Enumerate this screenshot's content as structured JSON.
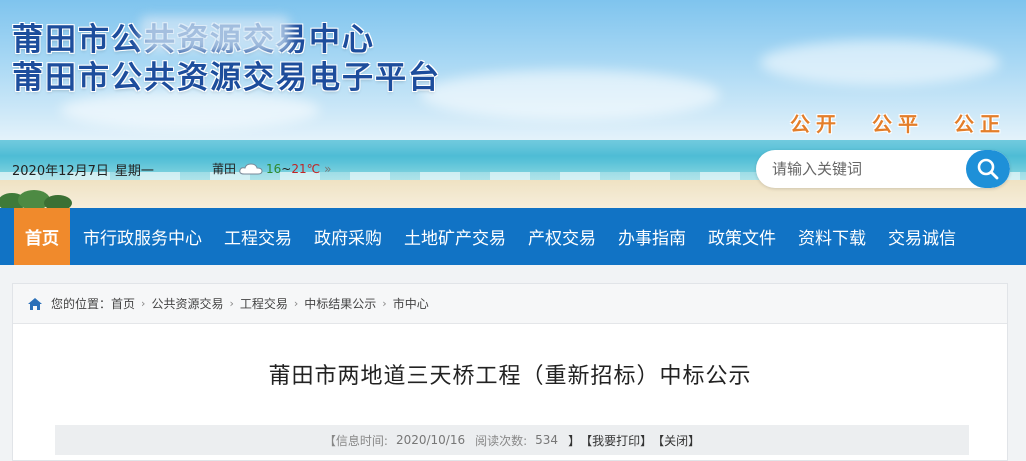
{
  "header": {
    "title_line1": "莆田市公共资源交易中心",
    "title_line2": "莆田市公共资源交易电子平台",
    "slogans": [
      "公开",
      "公平",
      "公正"
    ],
    "date": "2020年12月7日",
    "weekday": "星期一",
    "weather": {
      "city": "莆田",
      "icon": "cloud-icon",
      "temp_low": "16",
      "separator": "~",
      "temp_high": "21℃",
      "more": "»"
    },
    "search": {
      "placeholder": "请输入关键词",
      "icon": "search-icon"
    }
  },
  "nav": {
    "items": [
      {
        "label": "首页",
        "active": true
      },
      {
        "label": "市行政服务中心"
      },
      {
        "label": "工程交易"
      },
      {
        "label": "政府采购"
      },
      {
        "label": "土地矿产交易"
      },
      {
        "label": "产权交易"
      },
      {
        "label": "办事指南"
      },
      {
        "label": "政策文件"
      },
      {
        "label": "资料下载"
      },
      {
        "label": "交易诚信"
      }
    ]
  },
  "breadcrumb": {
    "prefix": "您的位置：",
    "items": [
      "首页",
      "公共资源交易",
      "工程交易",
      "中标结果公示",
      "市中心"
    ],
    "separator": "›"
  },
  "article": {
    "title": "莆田市两地道三天桥工程（重新招标）中标公示",
    "meta": {
      "time_label": "【信息时间:",
      "time_value": "2020/10/16",
      "views_label": "阅读次数:",
      "views_value": "534",
      "close_bracket": "】",
      "print": "【我要打印】",
      "close": "【关闭】"
    }
  },
  "colors": {
    "nav_bg": "#1173c5",
    "nav_active": "#f08a2c",
    "title_blue": "#1d4d9c",
    "slogan_orange": "#e37e2a",
    "search_button": "#1e90d8"
  }
}
